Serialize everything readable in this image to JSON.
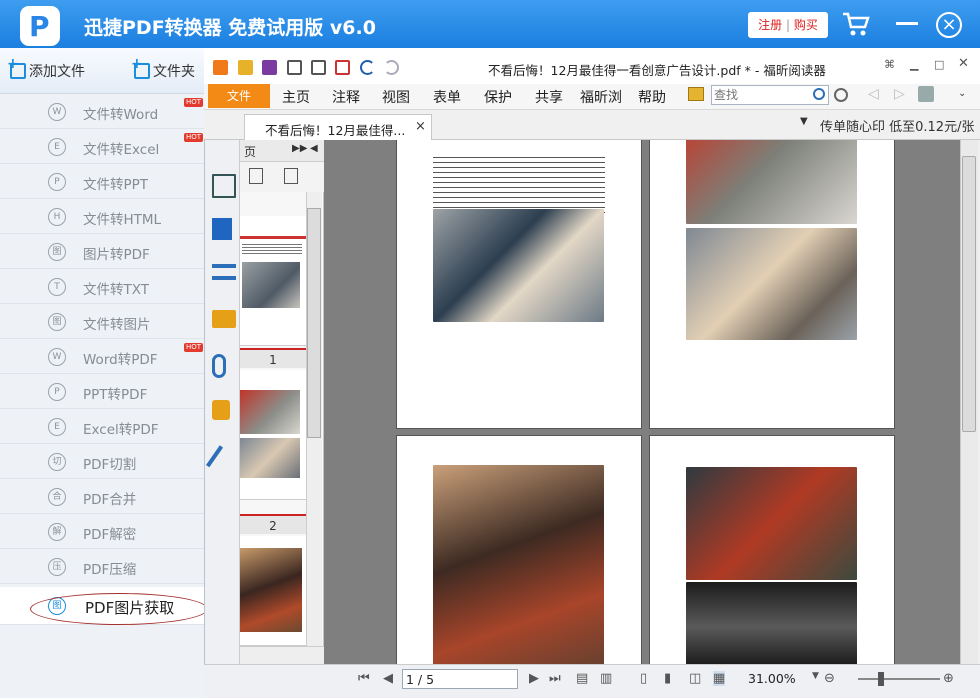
{
  "app": {
    "title": "迅捷PDF转换器 免费试用版 v6.0",
    "logo_letter": "P",
    "register_label": "注册",
    "buy_label": "购买",
    "separator": "|",
    "brand_color": "#1b7fe0"
  },
  "sidebar": {
    "toolbar": {
      "add_file": "添加文件",
      "add_folder": "文件夹"
    },
    "items": [
      {
        "icon": "W",
        "label": "文件转Word",
        "hot": true
      },
      {
        "icon": "E",
        "label": "文件转Excel",
        "hot": true
      },
      {
        "icon": "P",
        "label": "文件转PPT",
        "hot": false
      },
      {
        "icon": "H",
        "label": "文件转HTML",
        "hot": false
      },
      {
        "icon": "图",
        "label": "图片转PDF",
        "hot": false
      },
      {
        "icon": "T",
        "label": "文件转TXT",
        "hot": false
      },
      {
        "icon": "图",
        "label": "文件转图片",
        "hot": false
      },
      {
        "icon": "W",
        "label": "Word转PDF",
        "hot": true
      },
      {
        "icon": "P",
        "label": "PPT转PDF",
        "hot": false
      },
      {
        "icon": "E",
        "label": "Excel转PDF",
        "hot": false
      },
      {
        "icon": "切",
        "label": "PDF切割",
        "hot": false
      },
      {
        "icon": "合",
        "label": "PDF合并",
        "hot": false
      },
      {
        "icon": "解",
        "label": "PDF解密",
        "hot": false
      },
      {
        "icon": "压",
        "label": "PDF压缩",
        "hot": false
      }
    ],
    "hot_badge": "HOT",
    "active_item": {
      "icon": "图",
      "label": "PDF图片获取"
    }
  },
  "reader": {
    "window_title": "不看后悔！12月最佳得一看创意广告设计.pdf * - 福昕阅读器",
    "file_tab": "文件",
    "menu_tabs": [
      "主页",
      "注释",
      "视图",
      "表单",
      "保护",
      "共享",
      "福昕浏",
      "帮助"
    ],
    "search_placeholder": "查找",
    "doc_tab": "不看后悔！12月最佳得...",
    "doc_tab_close": "×",
    "promo": "传单随心印 低至0.12元/张",
    "thumb_header": "页",
    "page_labels": [
      "1",
      "2"
    ],
    "current_page": "1 / 5",
    "zoom": "31.00%"
  }
}
